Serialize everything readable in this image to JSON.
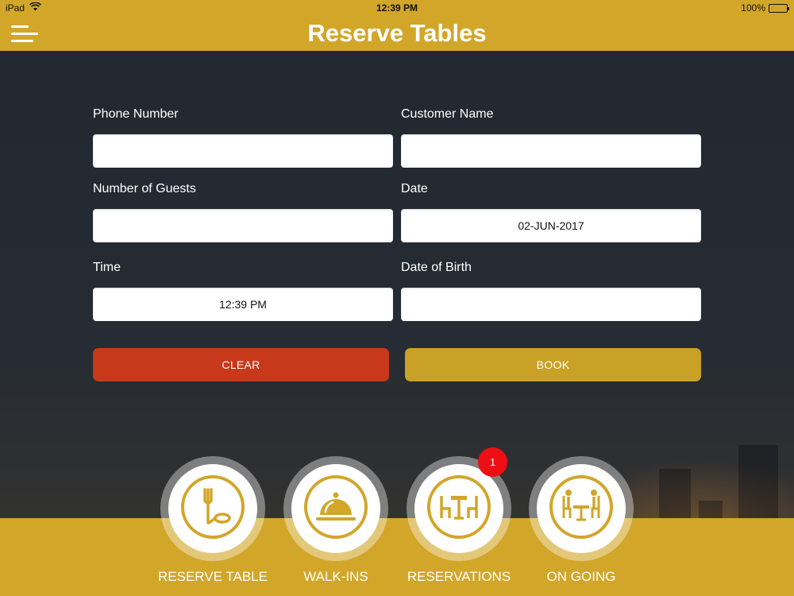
{
  "status_bar": {
    "device": "iPad",
    "time": "12:39 PM",
    "battery": "100%",
    "battery_level": 1.0
  },
  "nav": {
    "title": "Reserve Tables",
    "menu_icon": "hamburger-menu-icon"
  },
  "form": {
    "phone": {
      "label": "Phone Number",
      "value": ""
    },
    "customer_name": {
      "label": "Customer Name",
      "value": ""
    },
    "guests": {
      "label": "Number of Guests",
      "value": ""
    },
    "date": {
      "label": "Date",
      "value": "02-JUN-2017"
    },
    "time": {
      "label": "Time",
      "value": "12:39 PM"
    },
    "dob": {
      "label": "Date of Birth",
      "value": ""
    }
  },
  "actions": {
    "clear_label": "CLEAR",
    "book_label": "BOOK"
  },
  "tabs": [
    {
      "label": "RESERVE TABLE",
      "icon": "fork-plate-icon"
    },
    {
      "label": "WALK-INS",
      "icon": "cloche-icon"
    },
    {
      "label": "RESERVATIONS",
      "icon": "table-chairs-icon",
      "badge": "1"
    },
    {
      "label": "ON GOING",
      "icon": "dining-people-icon"
    }
  ],
  "colors": {
    "brand_gold": "#d2a629",
    "clear_red": "#c8391c",
    "book_gold": "#c8a126",
    "badge_red": "#ee0f14",
    "icon_gold": "#d2a629"
  }
}
